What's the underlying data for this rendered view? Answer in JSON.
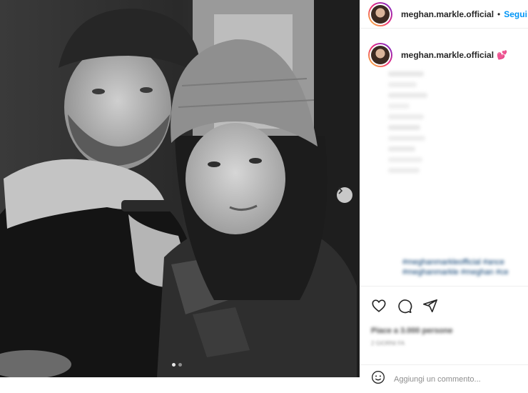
{
  "post": {
    "username": "meghan.markle.official",
    "follow_label": "Segui",
    "caption_emoji": "💕",
    "hashtags": [
      "#meghanmarkleofficial #ance",
      "#meghanmarkle #meghan #ce"
    ],
    "likes_text": "Piace a 3.000 persone",
    "date_text": "2 GIORNI FA",
    "comment_placeholder": "Aggiungi un commento..."
  },
  "carousel": {
    "total": 2,
    "current": 1
  },
  "icons": {
    "like": "heart-icon",
    "comment": "comment-icon",
    "share": "share-icon",
    "emoji": "emoji-icon",
    "next": "chevron-right-icon"
  },
  "colors": {
    "link": "#0095f6",
    "text": "#262626",
    "muted": "#8e8e8e"
  }
}
